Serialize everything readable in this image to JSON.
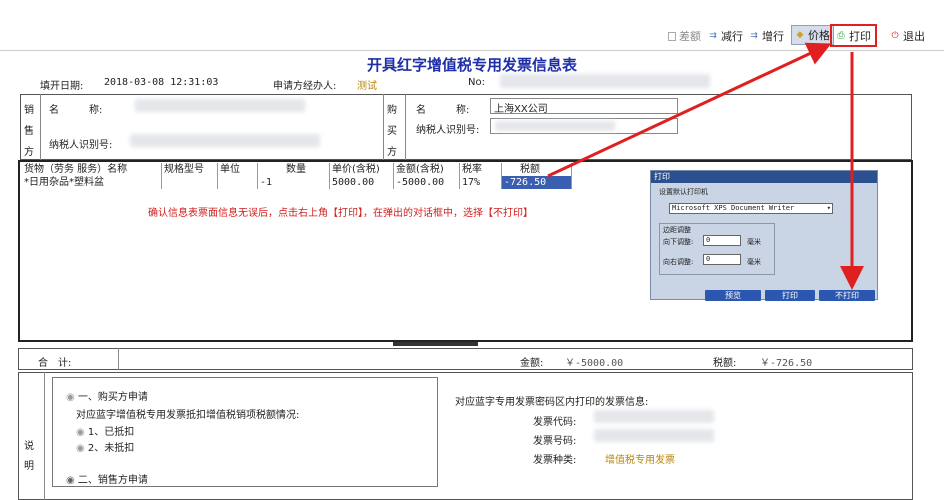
{
  "toolbar": {
    "items": [
      {
        "label": "差额",
        "icon": "doc-icon"
      },
      {
        "label": "减行",
        "icon": "arrow-icon"
      },
      {
        "label": "增行",
        "icon": "arrow-icon"
      },
      {
        "label": "价格",
        "icon": "tag-icon"
      },
      {
        "label": "打印",
        "icon": "print-icon"
      },
      {
        "label": "退出",
        "icon": "power-icon"
      }
    ]
  },
  "form": {
    "title": "开具红字增值税专用发票信息表",
    "fill_date_label": "填开日期:",
    "fill_date_value": "2018-03-08 12:31:03",
    "agent_label": "申请方经办人:",
    "agent_value": "测试",
    "no_label": "No:"
  },
  "seller": {
    "side_label": [
      "销",
      "售",
      "方"
    ],
    "name_label": "名　　　称:",
    "taxid_label": "纳税人识别号:"
  },
  "buyer": {
    "side_label": [
      "购",
      "买",
      "方"
    ],
    "name_label": "名　　　称:",
    "name_value": "上海XX公司",
    "taxid_label": "纳税人识别号:"
  },
  "goods": {
    "headers": [
      "货物（劳务 服务）名称",
      "规格型号",
      "单位",
      "数量",
      "单价(含税)",
      "金额(含税)",
      "税率",
      "税额"
    ],
    "rows": [
      [
        "*日用杂品*塑料盆",
        "",
        "",
        "-1",
        "5000.00",
        "-5000.00",
        "17%",
        "-726.50"
      ]
    ],
    "note": "确认信息表票面信息无误后，点击右上角【打印】，在弹出的对话框中，选择【不打印】"
  },
  "dialog": {
    "title": "打印",
    "printer_label": "设置默认打印机",
    "printer_value": "Microsoft XPS Document Writer",
    "margin_label": "边距调整",
    "down_label": "向下调整:",
    "down_value": "0",
    "right_label": "向右调整:",
    "right_value": "0",
    "unit": "毫米",
    "buttons": [
      "预览",
      "打印",
      "不打印"
    ]
  },
  "totals": {
    "label": "合　计:",
    "amount_label": "金额:",
    "amount_value": "￥-5000.00",
    "tax_label": "税额:",
    "tax_value": "￥-726.50"
  },
  "explain": {
    "side_label": [
      "说",
      "明"
    ],
    "option1": "一、购买方申请",
    "sub_question": "对应蓝字增值税专用发票抵扣增值税销项税额情况:",
    "sub1": "1、已抵扣",
    "sub2": "2、未抵扣",
    "option2": "二、销售方申请",
    "right_title": "对应蓝字专用发票密码区内打印的发票信息:",
    "code_label": "发票代码:",
    "number_label": "发票号码:",
    "type_label": "发票种类:",
    "type_value": "增值税专用发票"
  },
  "colors": {
    "title": "#1f2fa8",
    "red": "#e02020",
    "note": "#d02020",
    "value_orange": "#b8860b"
  }
}
